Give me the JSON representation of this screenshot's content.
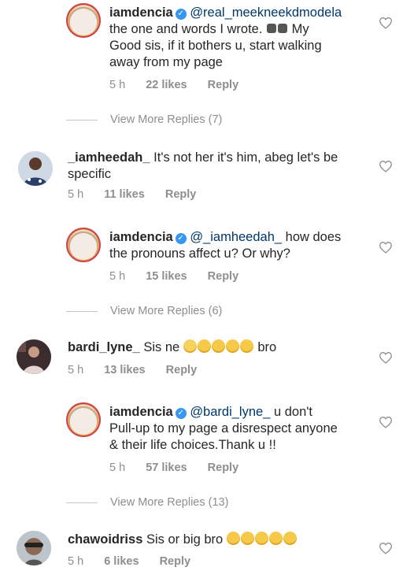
{
  "comments": [
    {
      "id": "c1",
      "username": "iamdencia",
      "verified": true,
      "mention": "@real_meekneekdmodela",
      "text_line1_after": "",
      "line2": "the one and words I wrote.",
      "line2_tail": "My",
      "line3": "Good sis, if it bothers u, start walking",
      "line4": "away from my page",
      "time": "5 h",
      "likes": "22 likes",
      "reply": "Reply",
      "view_more": "View More Replies (7)"
    },
    {
      "id": "c2",
      "username": "_iamheedah_",
      "text_line1": "It's not her it's him, abeg let's be",
      "text_line2": "specific",
      "time": "5 h",
      "likes": "11 likes",
      "reply": "Reply"
    },
    {
      "id": "c3",
      "username": "iamdencia",
      "verified": true,
      "mention": "@_iamheedah_",
      "text_line1": "how does",
      "text_line2": "the pronouns affect u? Or why?",
      "time": "5 h",
      "likes": "15 likes",
      "reply": "Reply",
      "view_more": "View More Replies (6)"
    },
    {
      "id": "c4",
      "username": "bardi_lyne_",
      "text_before": "Sis ne",
      "text_after": "bro",
      "time": "5 h",
      "likes": "13 likes",
      "reply": "Reply"
    },
    {
      "id": "c5",
      "username": "iamdencia",
      "verified": true,
      "mention": "@bardi_lyne_",
      "text_line1": "u don't",
      "text_line2": "Pull-up to my page a disrespect anyone",
      "text_line3": "& their life choices.Thank u !!",
      "time": "5 h",
      "likes": "57 likes",
      "reply": "Reply",
      "view_more": "View More Replies (13)"
    },
    {
      "id": "c6",
      "username": "chawoidriss",
      "text_before": "Sis or big bro",
      "time": "5 h",
      "likes": "6 likes",
      "reply": "Reply"
    }
  ],
  "colors": {
    "text": "#262626",
    "meta": "#8e8e8e",
    "mention": "#00376b",
    "verified": "#3897f0"
  },
  "icons": {
    "like": "heart-outline-icon",
    "verified": "verified-badge-icon"
  }
}
